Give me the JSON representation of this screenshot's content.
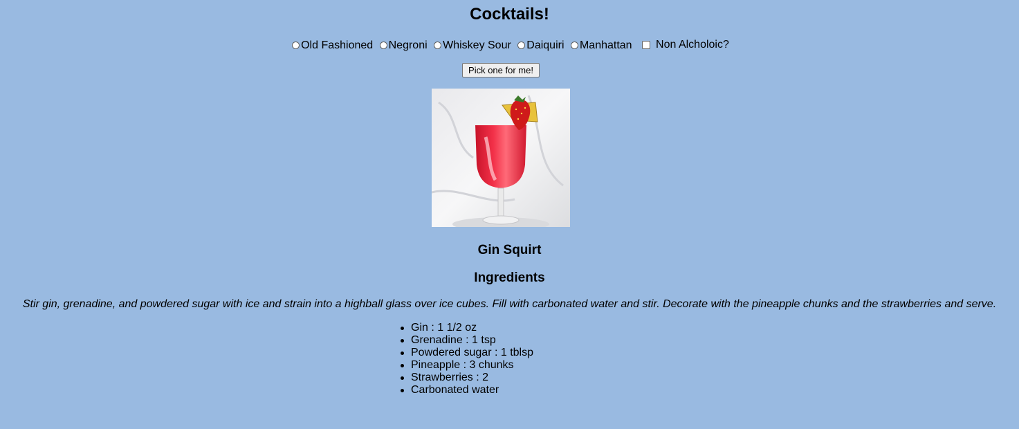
{
  "page": {
    "title": "Cocktails!",
    "background_color": "#99bae1"
  },
  "options": {
    "radios": [
      {
        "label": "Old Fashioned",
        "checked": false
      },
      {
        "label": "Negroni",
        "checked": false
      },
      {
        "label": "Whiskey Sour",
        "checked": false
      },
      {
        "label": "Daiquiri",
        "checked": false
      },
      {
        "label": "Manhattan",
        "checked": false
      }
    ],
    "non_alcoholic": {
      "label": "Non Alcholoic?",
      "checked": false
    }
  },
  "pick_button": {
    "label": "Pick one for me!"
  },
  "drink": {
    "image_icon": "cocktail-glass-photo",
    "name": "Gin Squirt",
    "ingredients_heading": "Ingredients",
    "instructions": "Stir gin, grenadine, and powdered sugar with ice and strain into a highball glass over ice cubes. Fill with carbonated water and stir. Decorate with the pineapple chunks and the strawberries and serve.",
    "ingredients": [
      "Gin : 1 1/2 oz",
      "Grenadine : 1 tsp",
      "Powdered sugar : 1 tblsp",
      "Pineapple : 3 chunks",
      "Strawberries : 2",
      "Carbonated water"
    ]
  }
}
